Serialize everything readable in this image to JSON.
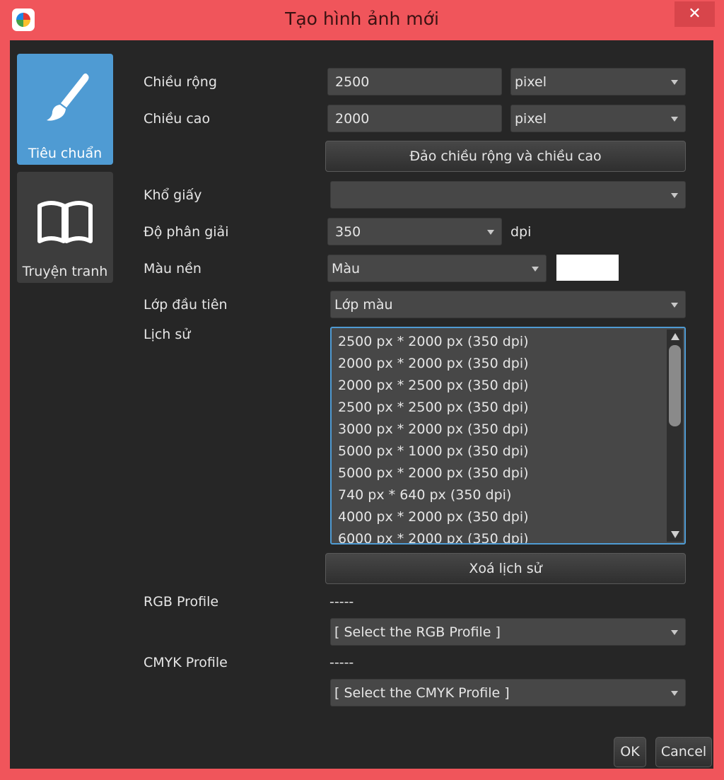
{
  "window": {
    "title": "Tạo hình ảnh mới",
    "close_label": "✕"
  },
  "sidebar": {
    "tabs": [
      {
        "label": "Tiêu chuẩn",
        "icon": "brush-icon",
        "selected": true
      },
      {
        "label": "Truyện tranh",
        "icon": "book-icon",
        "selected": false
      }
    ]
  },
  "form": {
    "width": {
      "label": "Chiều rộng",
      "value": "2500",
      "unit": "pixel"
    },
    "height": {
      "label": "Chiều cao",
      "value": "2000",
      "unit": "pixel"
    },
    "swap_button": "Đảo chiều rộng và chiều cao",
    "paper_size": {
      "label": "Khổ giấy",
      "value": ""
    },
    "resolution": {
      "label": "Độ phân giải",
      "value": "350",
      "unit": "dpi"
    },
    "background": {
      "label": "Màu nền",
      "value": "Màu",
      "swatch_color": "#ffffff"
    },
    "first_layer": {
      "label": "Lớp đầu tiên",
      "value": "Lớp màu"
    },
    "history": {
      "label": "Lịch sử",
      "items": [
        "2500 px * 2000 px (350 dpi)",
        "2000 px * 2000 px (350 dpi)",
        "2000 px * 2500 px (350 dpi)",
        "2500 px * 2500 px (350 dpi)",
        "3000 px * 2000 px (350 dpi)",
        "5000 px * 1000 px (350 dpi)",
        "5000 px * 2000 px (350 dpi)",
        "740 px * 640 px (350 dpi)",
        "4000 px * 2000 px (350 dpi)",
        "6000 px * 2000 px (350 dpi)"
      ]
    },
    "clear_history_button": "Xoá lịch sử",
    "rgb_profile": {
      "label": "RGB Profile",
      "current": "-----",
      "select": "[ Select the RGB Profile ]"
    },
    "cmyk_profile": {
      "label": "CMYK Profile",
      "current": "-----",
      "select": "[ Select the CMYK Profile ]"
    }
  },
  "footer": {
    "ok": "OK",
    "cancel": "Cancel"
  },
  "colors": {
    "frame": "#f0555b",
    "panel": "#262626",
    "field": "#474747",
    "accent": "#4f9bd3"
  }
}
